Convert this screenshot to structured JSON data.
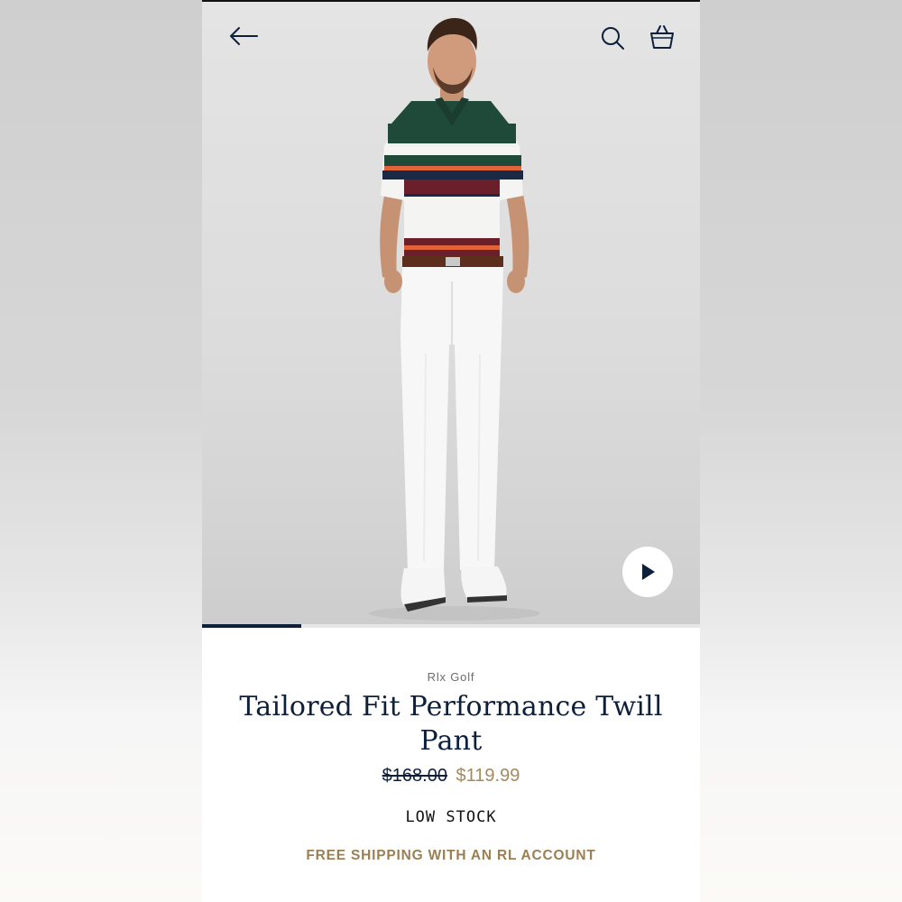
{
  "colors": {
    "navy": "#0d1f3a",
    "gold": "#a38a5d",
    "shipping_gold": "#9b7f52"
  },
  "header": {
    "back_icon": "arrow-left-icon",
    "search_icon": "search-icon",
    "bag_icon": "shopping-bag-icon"
  },
  "hero": {
    "play_icon": "play-icon"
  },
  "carousel": {
    "progress_fraction": 0.2
  },
  "product": {
    "brand": "Rlx Golf",
    "title": "Tailored Fit Performance Twill Pant",
    "price_original": "$168.00",
    "price_sale": "$119.99",
    "stock_status": "LOW STOCK",
    "shipping_message": "FREE SHIPPING WITH AN RL ACCOUNT"
  }
}
